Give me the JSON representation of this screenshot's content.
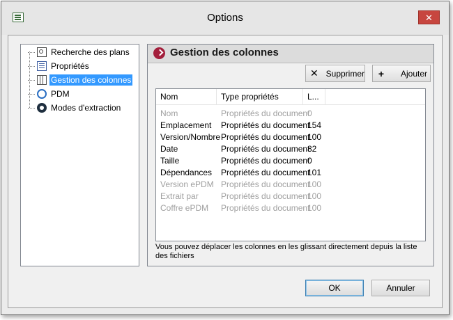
{
  "window": {
    "title": "Options",
    "close_glyph": "✕"
  },
  "tree": {
    "items": [
      {
        "label": "Recherche des plans",
        "icon": "search-plans-icon"
      },
      {
        "label": "Propriétés",
        "icon": "properties-icon"
      },
      {
        "label": "Gestion des colonnes",
        "icon": "columns-icon",
        "selected": true
      },
      {
        "label": "PDM",
        "icon": "pdm-icon"
      },
      {
        "label": "Modes d'extraction",
        "icon": "gear-icon"
      }
    ]
  },
  "panel": {
    "title": "Gestion des colonnes",
    "supprimer_label": "Supprimer",
    "supprimer_glyph": "✕",
    "ajouter_label": "Ajouter",
    "ajouter_glyph": "+"
  },
  "list": {
    "headers": [
      "Nom",
      "Type propriétés",
      "L..."
    ],
    "rows": [
      {
        "nom": "Nom",
        "type": "Propriétés du document",
        "l": "0",
        "enabled": false
      },
      {
        "nom": "Emplacement",
        "type": "Propriétés du document",
        "l": "154",
        "enabled": true
      },
      {
        "nom": "Version/Nombre",
        "type": "Propriétés du document",
        "l": "100",
        "enabled": true
      },
      {
        "nom": "Date",
        "type": "Propriétés du document",
        "l": "82",
        "enabled": true
      },
      {
        "nom": "Taille",
        "type": "Propriétés du document",
        "l": "0",
        "enabled": true
      },
      {
        "nom": "Dépendances",
        "type": "Propriétés du document",
        "l": "101",
        "enabled": true
      },
      {
        "nom": "Version ePDM",
        "type": "Propriétés du document",
        "l": "100",
        "enabled": false
      },
      {
        "nom": "Extrait par",
        "type": "Propriétés du document",
        "l": "100",
        "enabled": false
      },
      {
        "nom": "Coffre ePDM",
        "type": "Propriétés du document",
        "l": "100",
        "enabled": false
      }
    ]
  },
  "hint": "Vous pouvez déplacer les colonnes en les glissant directement depuis la liste des fichiers",
  "buttons": {
    "ok": "OK",
    "cancel": "Annuler"
  },
  "colors": {
    "selection": "#3399ff",
    "header_icon": "#a31f3c",
    "close_button": "#c7463f",
    "disabled_text": "#a0a0a0"
  }
}
